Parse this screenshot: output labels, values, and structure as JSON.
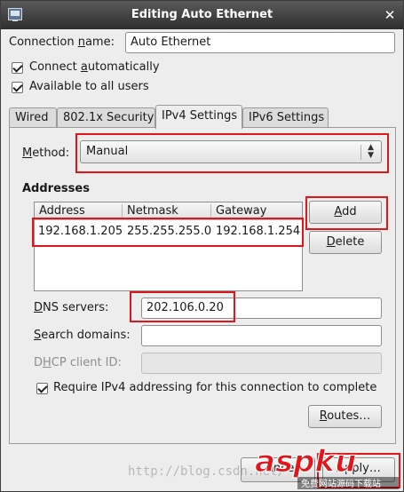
{
  "window": {
    "title": "Editing Auto Ethernet"
  },
  "connection_name": {
    "label": "Connection name:",
    "value": "Auto Ethernet"
  },
  "checkboxes": {
    "connect_automatically": {
      "label": "Connect automatically",
      "checked": true
    },
    "available_to_all_users": {
      "label": "Available to all users",
      "checked": true
    }
  },
  "tabs": [
    {
      "label": "Wired",
      "active": false
    },
    {
      "label": "802.1x Security",
      "active": false
    },
    {
      "label": "IPv4 Settings",
      "active": true
    },
    {
      "label": "IPv6 Settings",
      "active": false
    }
  ],
  "ipv4": {
    "method_label": "Method:",
    "method_value": "Manual",
    "addresses_heading": "Addresses",
    "columns": [
      "Address",
      "Netmask",
      "Gateway"
    ],
    "rows": [
      [
        "192.168.1.205",
        "255.255.255.0",
        "192.168.1.254"
      ]
    ],
    "add_button": "Add",
    "delete_button": "Delete",
    "dns_label": "DNS servers:",
    "dns_value": "202.106.0.20",
    "search_label": "Search domains:",
    "search_value": "",
    "dhcp_label": "DHCP client ID:",
    "dhcp_value": "",
    "require_label": "Require IPv4 addressing for this connection to complete",
    "require_checked": true,
    "routes_button": "Routes…"
  },
  "footer": {
    "cancel_button": "Cancel",
    "apply_button": "Apply…"
  },
  "watermark": {
    "text": "http://blog.csdn.net/",
    "logo_text": "aspku",
    "logo_sub": "免费网站源码下载站"
  },
  "colors": {
    "highlight": "#e0161b",
    "titlebar": "#3a3a3a"
  }
}
